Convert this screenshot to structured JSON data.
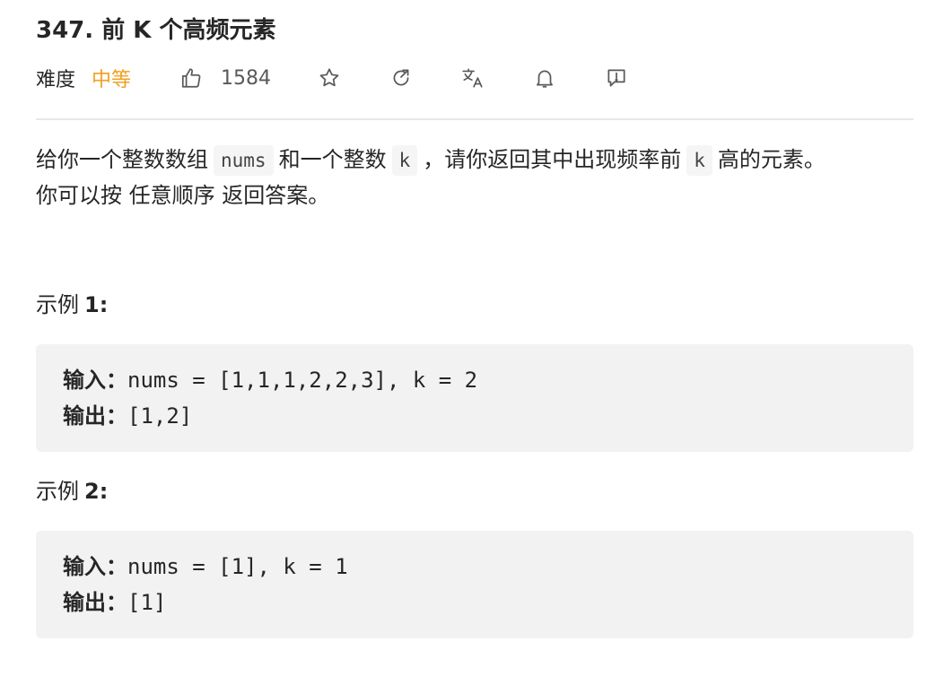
{
  "problem": {
    "title": "347. 前 K 个高频元素",
    "difficulty_label": "难度",
    "difficulty_value": "中等",
    "likes": "1584"
  },
  "icons": {
    "like": "thumbs-up-icon",
    "star": "star-icon",
    "share": "share-icon",
    "translate": "translate-icon",
    "bell": "bell-icon",
    "feedback": "feedback-icon"
  },
  "description": {
    "line1_part1": "给你一个整数数组",
    "code_nums": "nums",
    "line1_part2": "和一个整数",
    "code_k1": "k",
    "line1_part3": "，请你返回其中出现频率前",
    "code_k2": "k",
    "line1_part4": "高的元素。",
    "line2": "你可以按 任意顺序 返回答案。"
  },
  "examples": [
    {
      "label": "示例",
      "number": "1:",
      "input_label": "输入：",
      "input_value": "nums = [1,1,1,2,2,3], k = 2",
      "output_label": "输出：",
      "output_value": "[1,2]"
    },
    {
      "label": "示例",
      "number": "2:",
      "input_label": "输入：",
      "input_value": "nums = [1], k = 1",
      "output_label": "输出：",
      "output_value": "[1]"
    }
  ],
  "colors": {
    "difficulty_medium": "#f0a020",
    "text": "#262626",
    "code_bg": "#f2f2f2"
  }
}
